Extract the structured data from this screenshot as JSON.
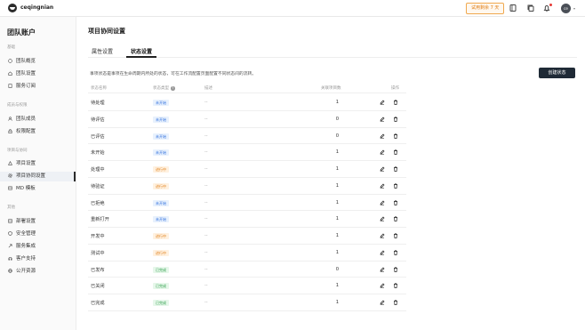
{
  "topbar": {
    "brand": "ceqingnian",
    "trial": "试用剩余 7 天",
    "avatar": "ce"
  },
  "sidebar": {
    "title": "团队账户",
    "sections": [
      {
        "label": "基础",
        "items": [
          {
            "label": "团队概览",
            "icon": "home-icon"
          },
          {
            "label": "团队设置",
            "icon": "house-icon"
          },
          {
            "label": "服务订阅",
            "icon": "doc-icon"
          }
        ]
      },
      {
        "label": "成员与权限",
        "items": [
          {
            "label": "团队成员",
            "icon": "users-icon"
          },
          {
            "label": "权限配置",
            "icon": "lock-icon"
          }
        ]
      },
      {
        "label": "项目与协同",
        "items": [
          {
            "label": "项目设置",
            "icon": "triangle-icon"
          },
          {
            "label": "项目协同设置",
            "icon": "gear-icon"
          },
          {
            "label": "MD 模板",
            "icon": "template-icon"
          }
        ]
      },
      {
        "label": "其他",
        "items": [
          {
            "label": "部署设置",
            "icon": "server-icon"
          },
          {
            "label": "安全管理",
            "icon": "shield-icon"
          },
          {
            "label": "服务集成",
            "icon": "link-icon"
          },
          {
            "label": "客户支持",
            "icon": "support-icon"
          },
          {
            "label": "公开资源",
            "icon": "globe-icon"
          }
        ]
      }
    ],
    "active_item": "项目协同设置"
  },
  "main": {
    "title": "项目协同设置",
    "tabs": [
      {
        "label": "属性设置",
        "active": false
      },
      {
        "label": "状态设置",
        "active": true
      }
    ],
    "description": "事项状态是事项在生命周期内所处的状态，可在工作流配置页面配置不同状态间的流转。",
    "create_button": "创建状态",
    "columns": [
      "状态名称",
      "状态类型",
      "描述",
      "关联项目数",
      "操作"
    ],
    "rows": [
      {
        "name": "待处理",
        "type": "未开始",
        "kind": "todo",
        "desc": "--",
        "count": "1"
      },
      {
        "name": "待评估",
        "type": "未开始",
        "kind": "todo",
        "desc": "--",
        "count": "0"
      },
      {
        "name": "已评估",
        "type": "未开始",
        "kind": "todo",
        "desc": "--",
        "count": "0"
      },
      {
        "name": "未开始",
        "type": "未开始",
        "kind": "todo",
        "desc": "--",
        "count": "1"
      },
      {
        "name": "处理中",
        "type": "进行中",
        "kind": "doing",
        "desc": "--",
        "count": "1"
      },
      {
        "name": "待验证",
        "type": "进行中",
        "kind": "doing",
        "desc": "--",
        "count": "1"
      },
      {
        "name": "已拒绝",
        "type": "未开始",
        "kind": "todo",
        "desc": "--",
        "count": "1"
      },
      {
        "name": "重新打开",
        "type": "未开始",
        "kind": "todo",
        "desc": "--",
        "count": "1"
      },
      {
        "name": "开发中",
        "type": "进行中",
        "kind": "doing",
        "desc": "--",
        "count": "1"
      },
      {
        "name": "测试中",
        "type": "进行中",
        "kind": "doing",
        "desc": "--",
        "count": "1"
      },
      {
        "name": "已发布",
        "type": "已完成",
        "kind": "done",
        "desc": "--",
        "count": "0"
      },
      {
        "name": "已关闭",
        "type": "已完成",
        "kind": "done",
        "desc": "--",
        "count": "1"
      },
      {
        "name": "已完成",
        "type": "已完成",
        "kind": "done",
        "desc": "--",
        "count": "1"
      }
    ]
  },
  "colors": {
    "primary_button": "#1f2a36",
    "badge_todo": "#2f6fde",
    "badge_doing": "#e07e16",
    "badge_done": "#2e9e4a",
    "trial_accent": "#e07e16"
  }
}
